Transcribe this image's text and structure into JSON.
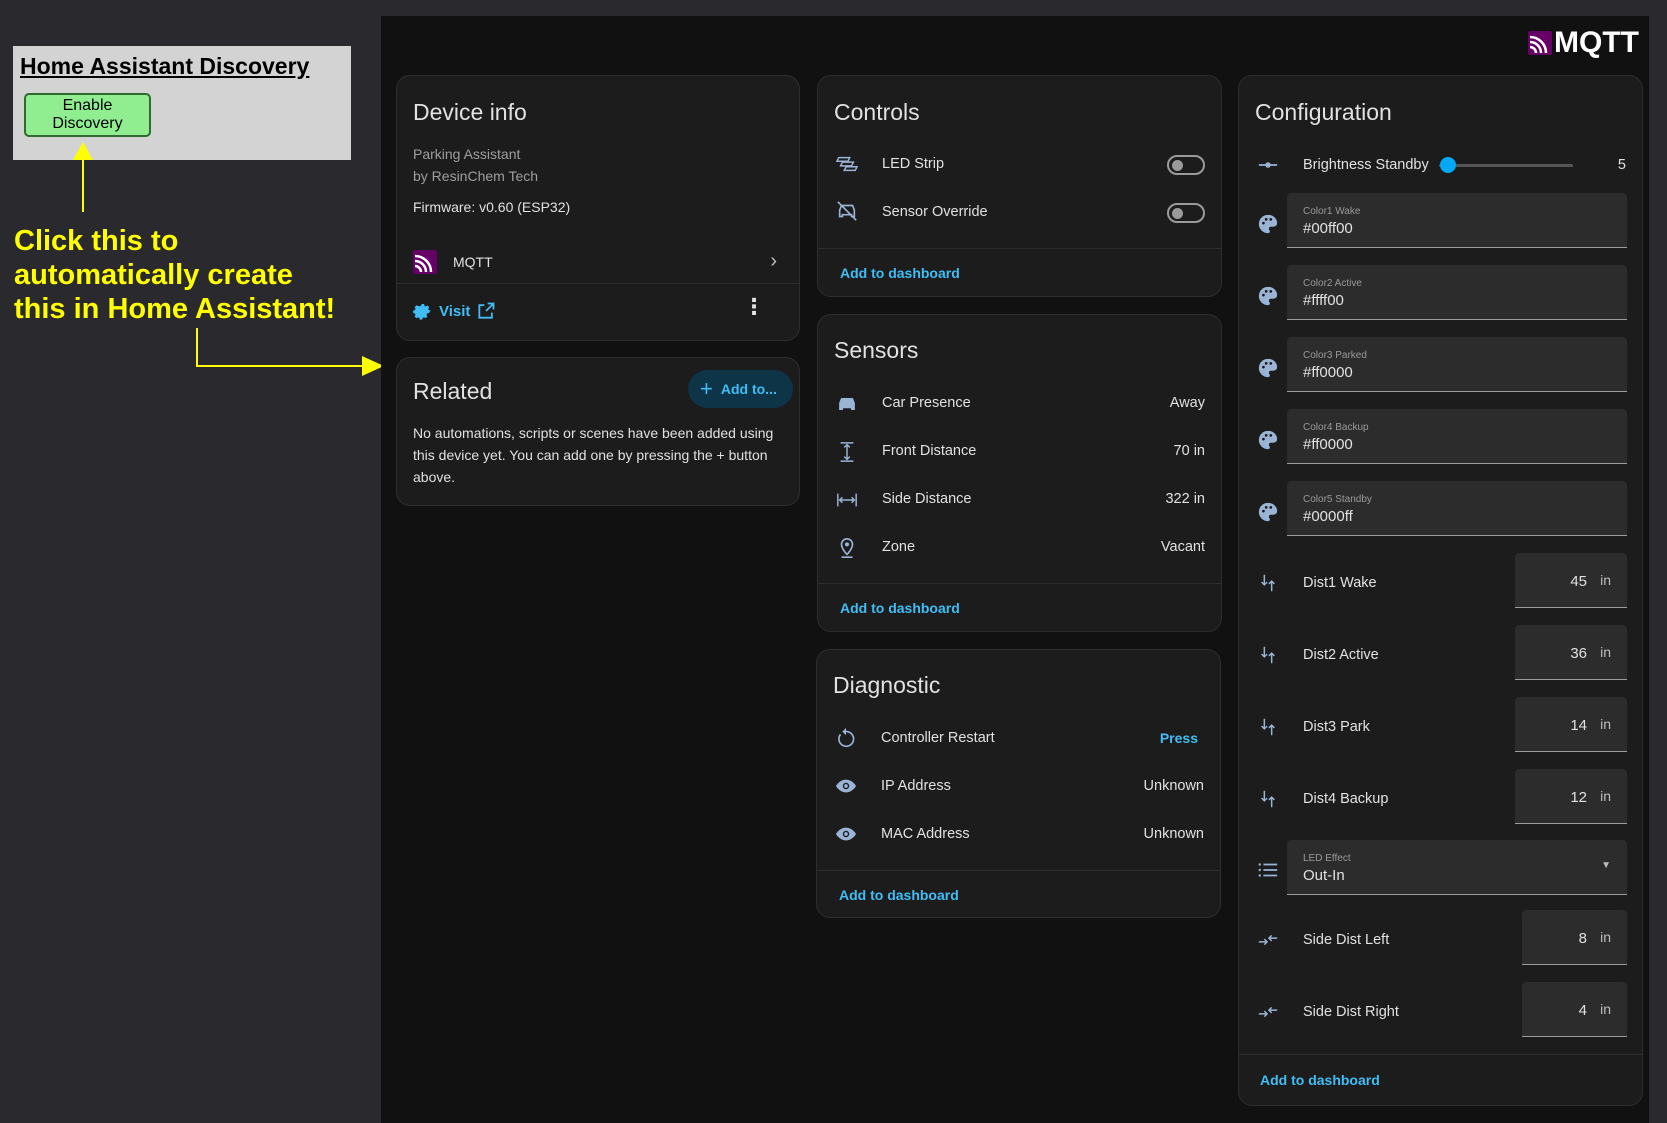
{
  "annotation": {
    "discovery_title": "Home Assistant Discovery",
    "enable_button": "Enable Discovery",
    "callout": "Click this to\nautomatically create\nthis in Home Assistant!"
  },
  "logo": {
    "text": "MQTT"
  },
  "device_info": {
    "title": "Device info",
    "model": "Parking Assistant",
    "manufacturer": "by ResinChem Tech",
    "firmware": "Firmware: v0.60 (ESP32)",
    "integration": "MQTT",
    "visit_label": "Visit"
  },
  "related": {
    "title": "Related",
    "add_button": "Add to...",
    "text": "No automations, scripts or scenes have been added using this device yet. You can add one by pressing the + button above."
  },
  "controls": {
    "title": "Controls",
    "items": [
      {
        "label": "LED Strip",
        "icon": "led-strip-icon",
        "state": false
      },
      {
        "label": "Sensor Override",
        "icon": "car-off-icon",
        "state": false
      }
    ],
    "add_to_dashboard": "Add to dashboard"
  },
  "sensors": {
    "title": "Sensors",
    "items": [
      {
        "label": "Car Presence",
        "value": "Away",
        "icon": "car-icon"
      },
      {
        "label": "Front Distance",
        "value": "70 in",
        "icon": "arrow-vertical-icon"
      },
      {
        "label": "Side Distance",
        "value": "322 in",
        "icon": "arrow-horizontal-icon"
      },
      {
        "label": "Zone",
        "value": "Vacant",
        "icon": "map-marker-icon"
      }
    ],
    "add_to_dashboard": "Add to dashboard"
  },
  "diagnostic": {
    "title": "Diagnostic",
    "items": [
      {
        "label": "Controller Restart",
        "value": "Press",
        "icon": "restart-icon"
      },
      {
        "label": "IP Address",
        "value": "Unknown",
        "icon": "eye-icon"
      },
      {
        "label": "MAC Address",
        "value": "Unknown",
        "icon": "eye-icon"
      }
    ],
    "add_to_dashboard": "Add to dashboard"
  },
  "configuration": {
    "title": "Configuration",
    "brightness": {
      "label": "Brightness Standby",
      "value": "5",
      "level": 5
    },
    "colors": [
      {
        "label": "Color1 Wake",
        "value": "#00ff00"
      },
      {
        "label": "Color2 Active",
        "value": "#ffff00"
      },
      {
        "label": "Color3 Parked",
        "value": "#ff0000"
      },
      {
        "label": "Color4 Backup",
        "value": "#ff0000"
      },
      {
        "label": "Color5 Standby",
        "value": "#0000ff"
      }
    ],
    "distances": [
      {
        "label": "Dist1 Wake",
        "value": "45",
        "unit": "in"
      },
      {
        "label": "Dist2 Active",
        "value": "36",
        "unit": "in"
      },
      {
        "label": "Dist3 Park",
        "value": "14",
        "unit": "in"
      },
      {
        "label": "Dist4 Backup",
        "value": "12",
        "unit": "in"
      }
    ],
    "led_effect": {
      "label": "LED Effect",
      "value": "Out-In"
    },
    "side_dists": [
      {
        "label": "Side Dist Left",
        "value": "8",
        "unit": "in"
      },
      {
        "label": "Side Dist Right",
        "value": "4",
        "unit": "in"
      }
    ],
    "add_to_dashboard": "Add to dashboard"
  },
  "colors": {
    "accent": "#41bdf5",
    "callout": "#ffff00",
    "enable_button": "#90ee90"
  }
}
